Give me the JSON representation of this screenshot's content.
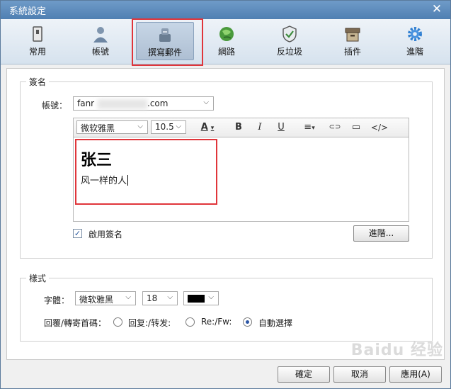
{
  "window": {
    "title": "系統設定",
    "close": "✕"
  },
  "toolbar": {
    "items": [
      {
        "label": "常用",
        "icon": "general-icon"
      },
      {
        "label": "帳號",
        "icon": "account-icon"
      },
      {
        "label": "撰寫郵件",
        "icon": "compose-icon"
      },
      {
        "label": "網路",
        "icon": "network-icon"
      },
      {
        "label": "反垃圾",
        "icon": "antispam-shield-icon"
      },
      {
        "label": "插件",
        "icon": "plugin-box-icon"
      },
      {
        "label": "進階",
        "icon": "gear-icon"
      }
    ],
    "active_index": 2
  },
  "signature": {
    "group_title": "簽名",
    "account_label": "帳號：",
    "account_prefix": "fanr",
    "account_suffix": ".com",
    "font_name": "微软雅黑",
    "font_size": "10.5",
    "editor_buttons": {
      "font_color": "A",
      "bold": "B",
      "italic": "I",
      "underline": "U",
      "align": "≡",
      "link": "⊂⊃",
      "image": "▭",
      "html": "</>"
    },
    "content_name": "张三",
    "content_line": "风一样的人",
    "enable_label": "啟用簽名",
    "enabled": true,
    "advanced_button": "進階..."
  },
  "style": {
    "group_title": "樣式",
    "font_label": "字體：",
    "font_name": "微软雅黑",
    "font_size": "18",
    "color": "#000000",
    "reply_label": "回覆/轉寄首碼：",
    "options": [
      "回复:/转发:",
      "Re:/Fw:",
      "自動選擇"
    ],
    "selected_index": 2
  },
  "footer": {
    "ok": "確定",
    "cancel": "取消",
    "apply": "應用(A)"
  },
  "watermark": "Baidu 经验"
}
